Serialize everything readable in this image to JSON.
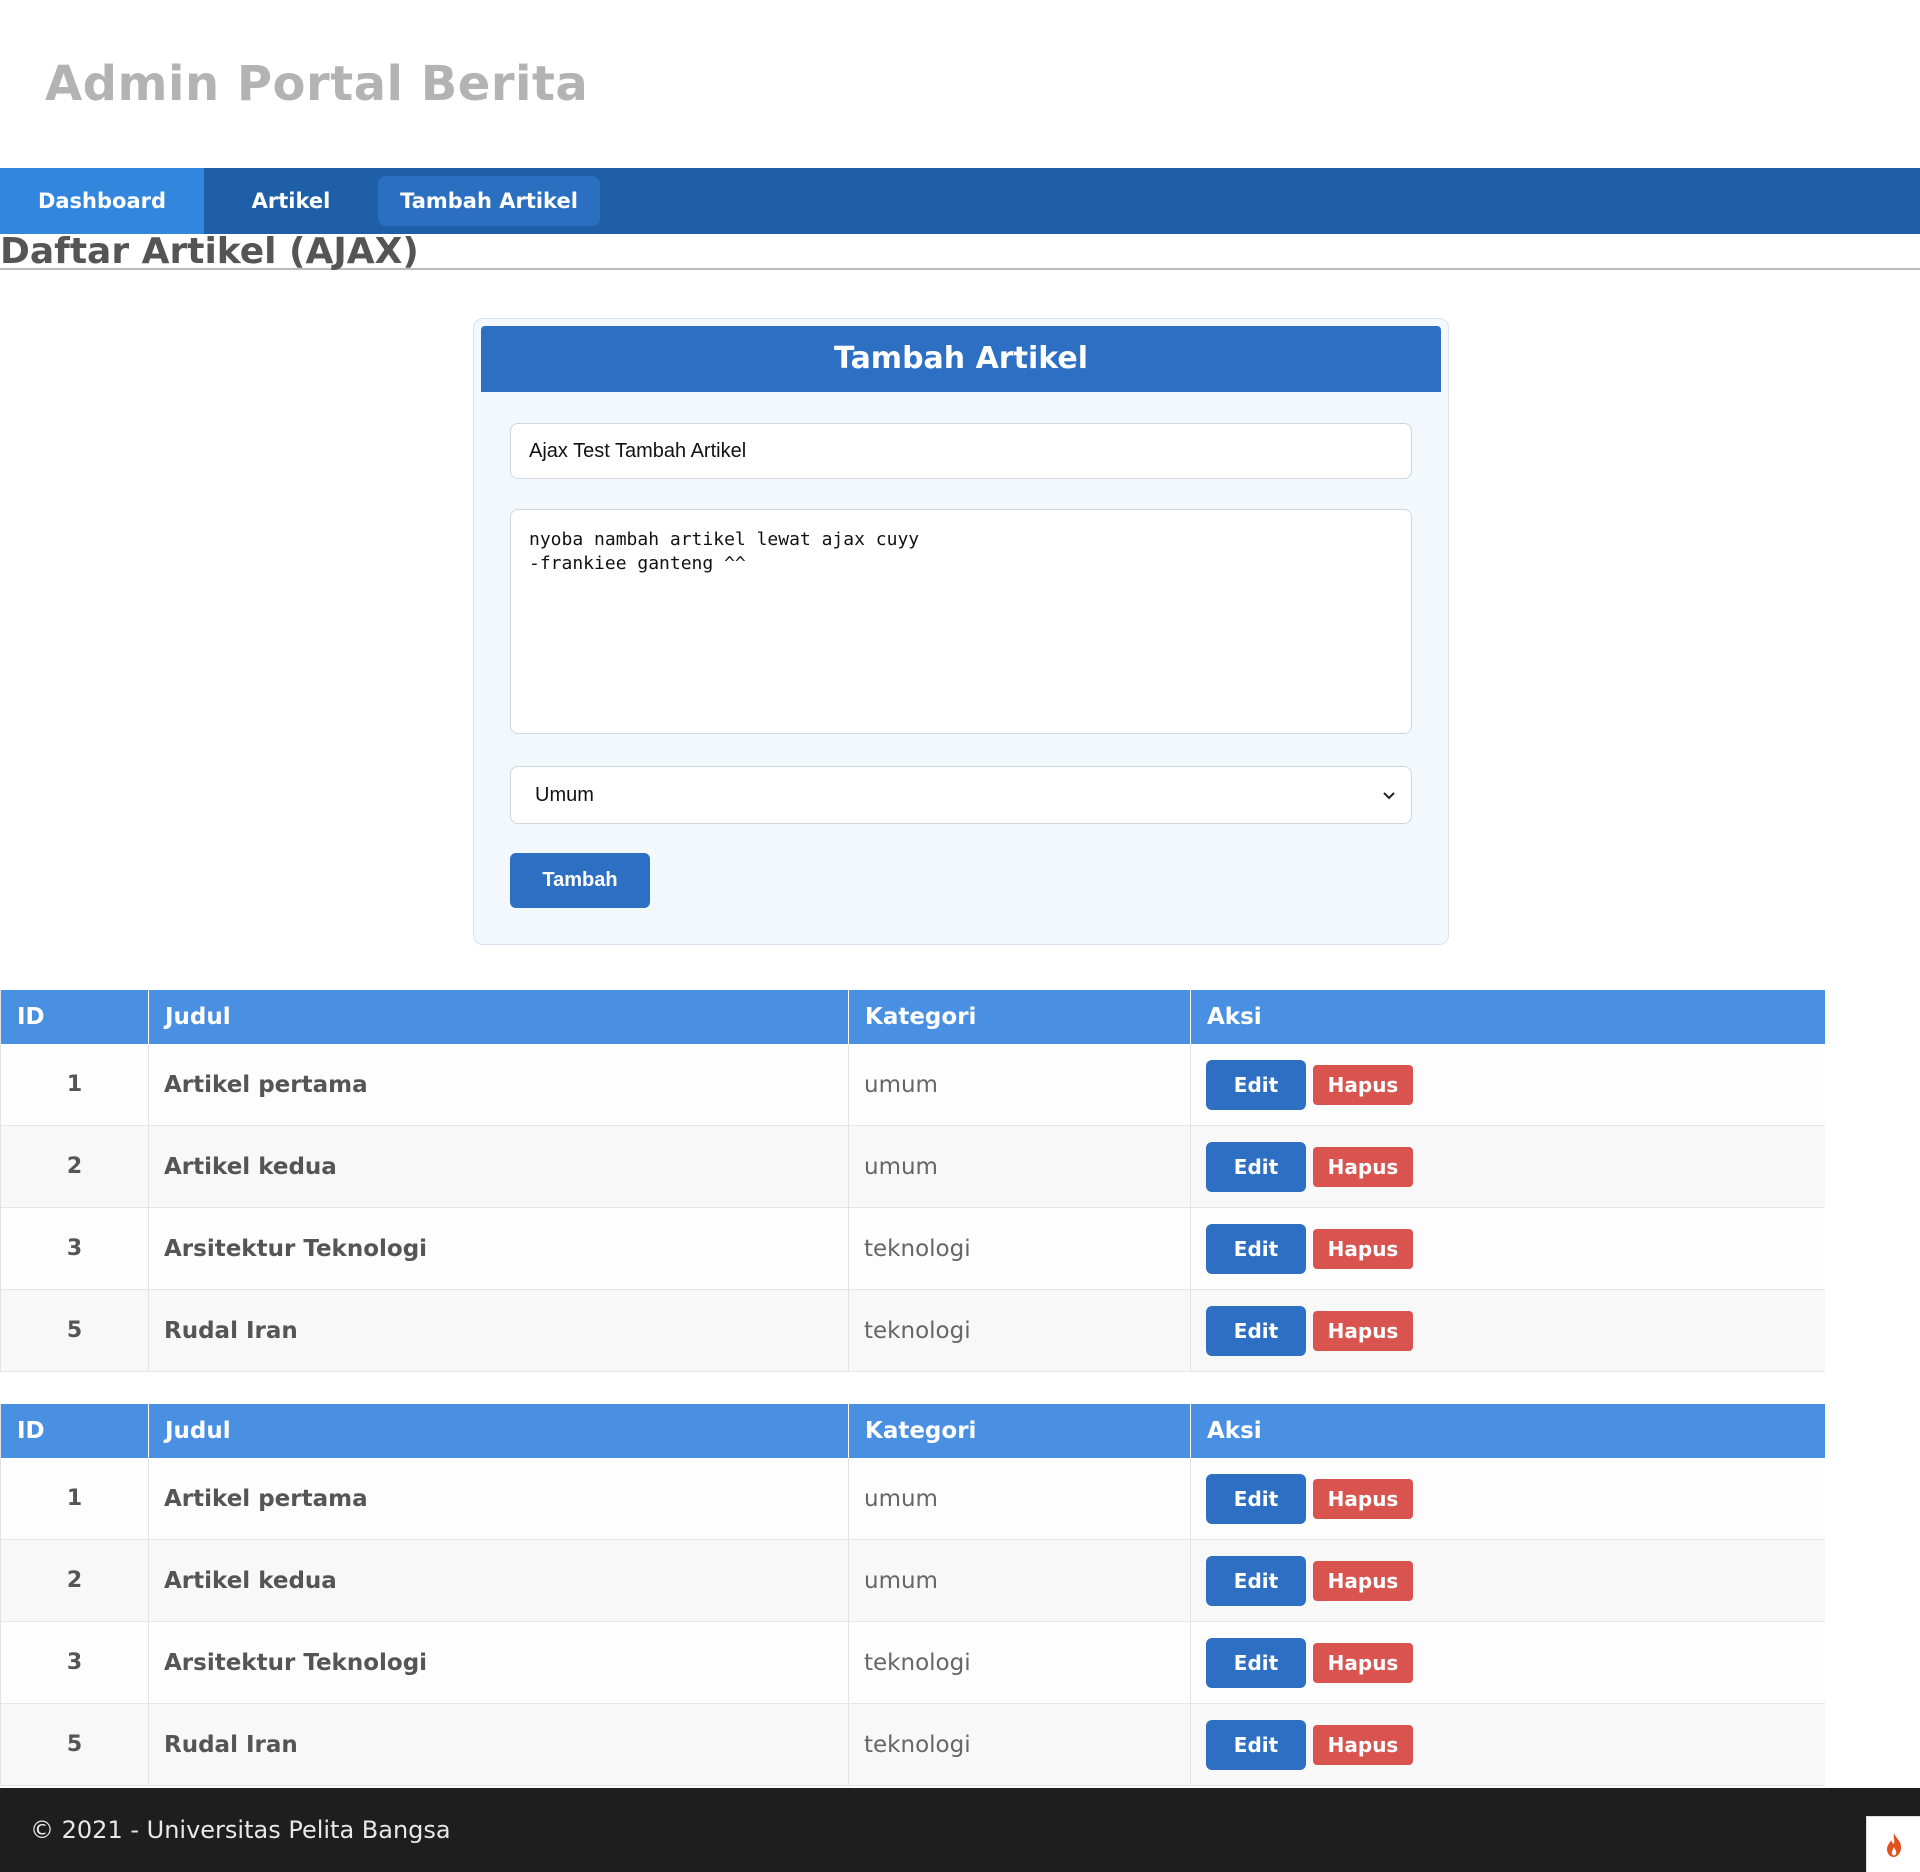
{
  "header": {
    "title": "Admin Portal Berita"
  },
  "nav": {
    "items": [
      {
        "label": "Dashboard"
      },
      {
        "label": "Artikel"
      },
      {
        "label": "Tambah Artikel"
      }
    ]
  },
  "page": {
    "title": "Daftar Artikel (AJAX)"
  },
  "form": {
    "title": "Tambah Artikel",
    "judul_value": "Ajax Test Tambah Artikel",
    "isi_value": "nyoba nambah artikel lewat ajax cuyy\n-frankiee ganteng ^^",
    "kategori_value": "Umum",
    "submit_label": "Tambah"
  },
  "table": {
    "headers": {
      "id": "ID",
      "judul": "Judul",
      "kategori": "Kategori",
      "aksi": "Aksi"
    },
    "edit_label": "Edit",
    "hapus_label": "Hapus",
    "rows": [
      {
        "id": "1",
        "judul": "Artikel pertama",
        "kategori": "umum"
      },
      {
        "id": "2",
        "judul": "Artikel kedua",
        "kategori": "umum"
      },
      {
        "id": "3",
        "judul": "Arsitektur Teknologi",
        "kategori": "teknologi"
      },
      {
        "id": "5",
        "judul": "Rudal Iran",
        "kategori": "teknologi"
      }
    ]
  },
  "footer": {
    "text": "© 2021 - Universitas Pelita Bangsa"
  },
  "colors": {
    "nav": "#1f5fa8",
    "nav_active": "#3386dd",
    "primary": "#2d6fc2",
    "table_head": "#4a90e2",
    "danger": "#d9534f",
    "footer": "#1e1e1e"
  },
  "icons": {
    "debug_toolbar": "flame-icon",
    "select_arrow": "chevron-down-icon"
  }
}
